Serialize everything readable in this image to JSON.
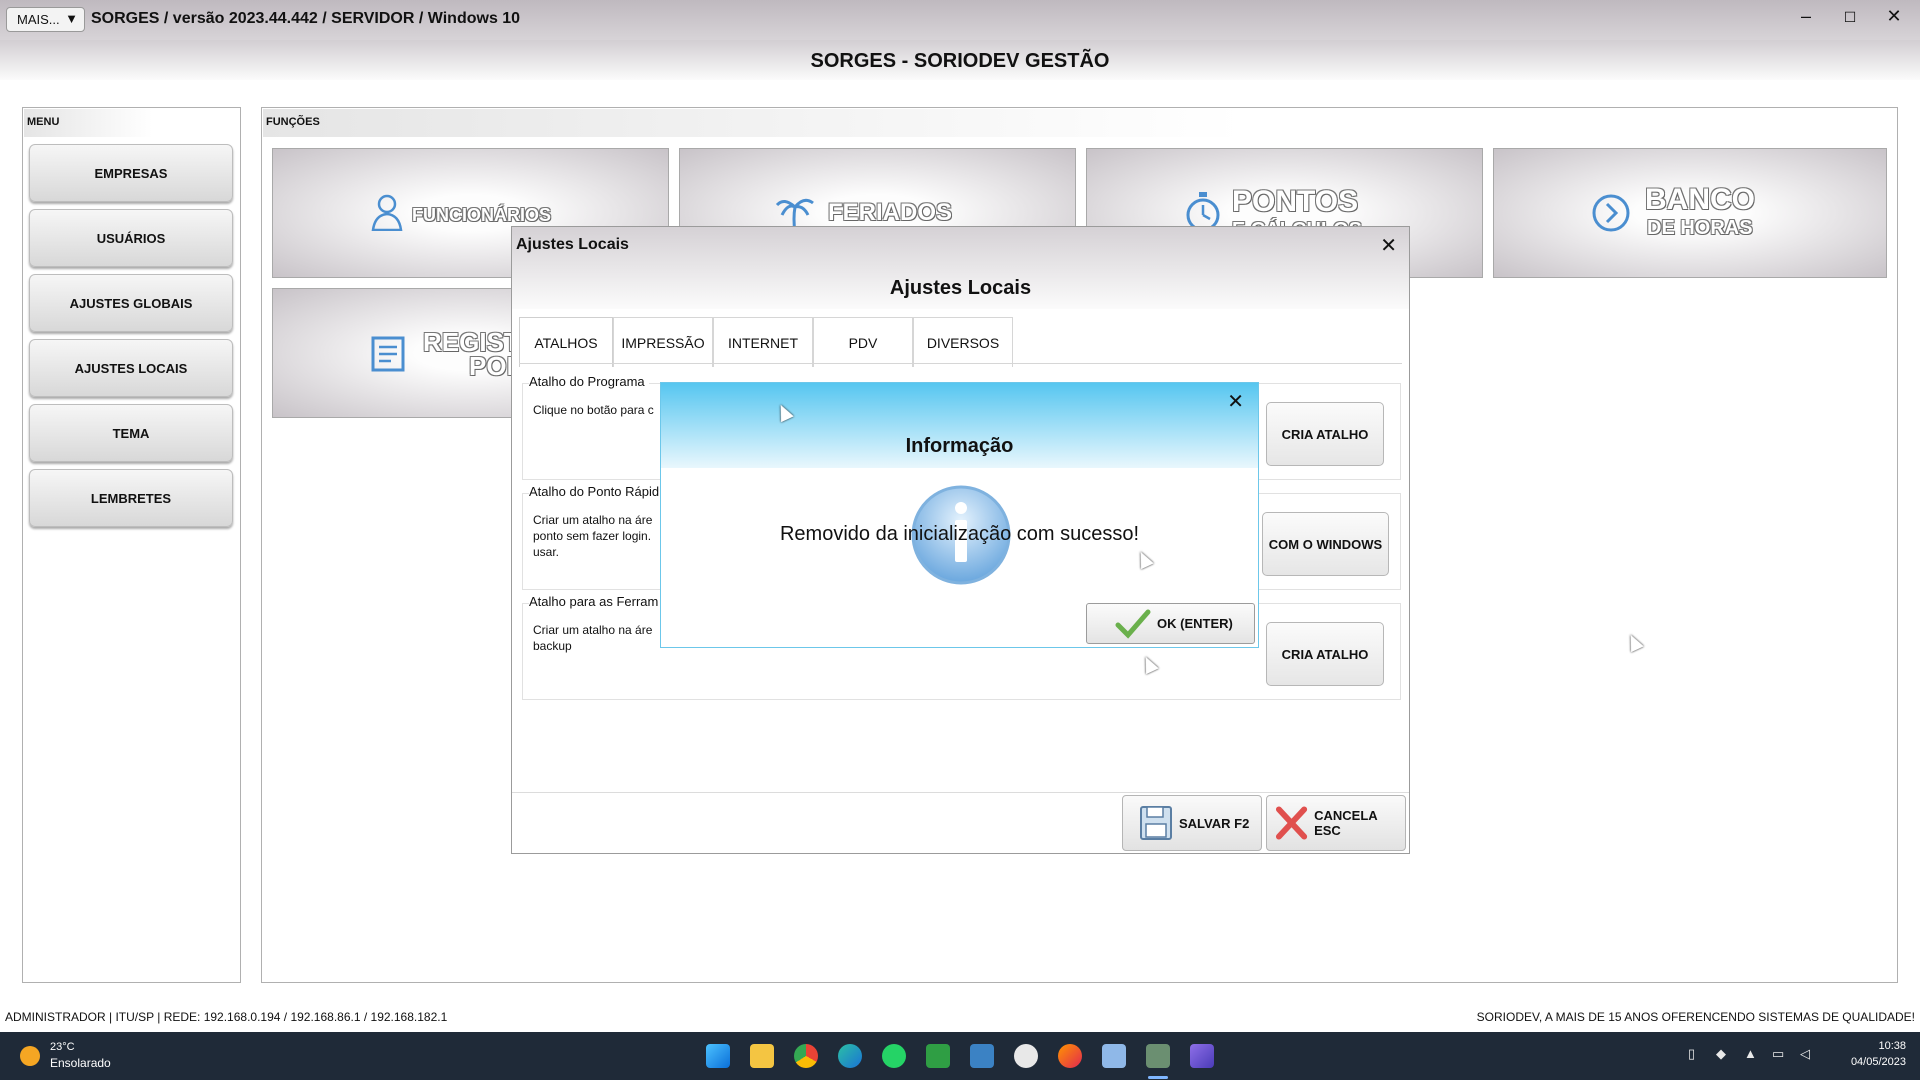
{
  "titlebar": {
    "mais_label": "MAIS...",
    "mais_arrow": "▼",
    "title": "SORGES / versão 2023.44.442 / SERVIDOR / Windows 10",
    "minimize": "–",
    "maximize": "☐",
    "close": "✕"
  },
  "header": {
    "title": "SORGES - SORIODEV GESTÃO"
  },
  "menu": {
    "label": "MENU",
    "items": [
      {
        "label": "EMPRESAS"
      },
      {
        "label": "USUÁRIOS"
      },
      {
        "label": "AJUSTES GLOBAIS"
      },
      {
        "label": "AJUSTES LOCAIS"
      },
      {
        "label": "TEMA"
      },
      {
        "label": "LEMBRETES"
      }
    ]
  },
  "functions": {
    "label": "FUNÇÕES",
    "tiles": [
      {
        "line1": "FUNCIONÁRIOS",
        "icon": "user-icon"
      },
      {
        "line1": "FERIADOS",
        "icon": "palm-tree-icon"
      },
      {
        "line1": "PONTOS",
        "line2": "E CÁLCULOS",
        "icon": "stopwatch-icon"
      },
      {
        "line1": "BANCO",
        "line2": "DE HORAS",
        "icon": "arrow-circle-icon"
      },
      {
        "line1": "REGIST",
        "line2": "PONT",
        "icon": "document-icon"
      }
    ]
  },
  "ajustes": {
    "title": "Ajustes Locais",
    "header": "Ajustes Locais",
    "close": "✕",
    "tabs": [
      {
        "label": "ATALHOS"
      },
      {
        "label": "IMPRESSÃO"
      },
      {
        "label": "INTERNET"
      },
      {
        "label": "PDV"
      },
      {
        "label": "DIVERSOS"
      }
    ],
    "groups": [
      {
        "title": "Atalho do Programa",
        "text": "Clique no botão para c",
        "button": "CRIA ATALHO"
      },
      {
        "title": "Atalho do Ponto Rápid",
        "text_lines": [
          "Criar um atalho na áre",
          "ponto sem fazer login.",
          "usar."
        ],
        "button": "COM O WINDOWS"
      },
      {
        "title": "Atalho para as Ferram",
        "text_lines": [
          "Criar um atalho na áre",
          "backup"
        ],
        "button": "CRIA ATALHO"
      }
    ],
    "save_label": "SALVAR F2",
    "cancel_label": "CANCELA ESC"
  },
  "info_dialog": {
    "title": "Informação",
    "close": "✕",
    "message": "Removido da inicialização com sucesso!",
    "ok_label": "OK (ENTER)"
  },
  "status": {
    "left": "ADMINISTRADOR |   ITU/SP |   REDE: 192.168.0.194 / 192.168.86.1 / 192.168.182.1",
    "right": "SORIODEV, A MAIS DE 15 ANOS OFERENCENDO SISTEMAS DE QUALIDADE!"
  },
  "taskbar": {
    "weather_temp": "23°C",
    "weather_desc": "Ensolarado",
    "time": "10:38",
    "date": "04/05/2023"
  },
  "colors": {
    "info_header": "#56c6f0",
    "taskbar": "#1f2a38"
  }
}
